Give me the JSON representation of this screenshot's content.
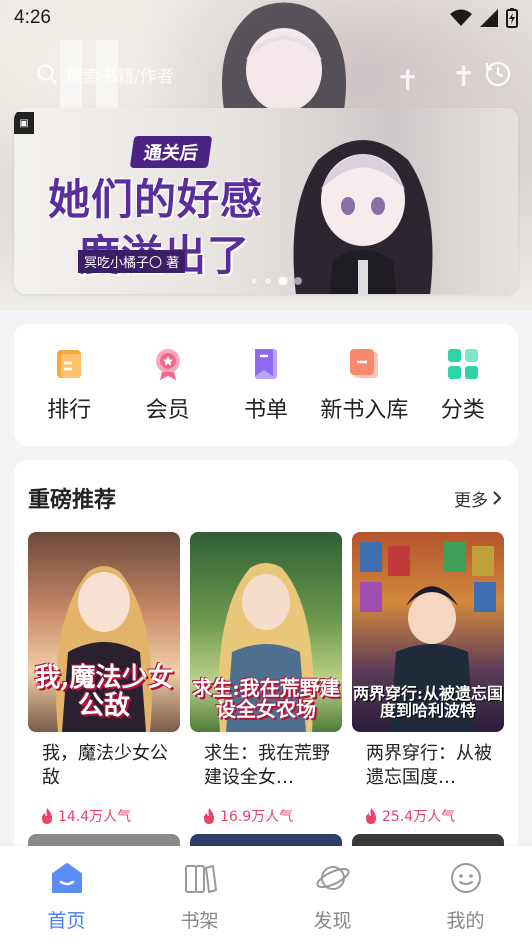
{
  "status_bar": {
    "time": "4:26"
  },
  "search": {
    "placeholder": "搜索书籍/作者"
  },
  "banner": {
    "badge": "通关后",
    "title_line1": "她们的好感",
    "title_line2": "度溢出了",
    "author": "冥吃小橘子〇 著",
    "page_count": 4,
    "active_index": 2
  },
  "quick_menu": [
    {
      "label": "排行",
      "icon": "ranking-icon",
      "color": "#f5a93c"
    },
    {
      "label": "会员",
      "icon": "vip-icon",
      "color": "#f06a8a"
    },
    {
      "label": "书单",
      "icon": "booklist-icon",
      "color": "#8d6af0"
    },
    {
      "label": "新书入库",
      "icon": "new-book-icon",
      "color": "#f58a6e"
    },
    {
      "label": "分类",
      "icon": "category-icon",
      "color": "#2fd3a8"
    }
  ],
  "recommend": {
    "title": "重磅推荐",
    "more": "更多",
    "books": [
      {
        "title": "我，魔法少女公敌",
        "popularity": "14.4万人气",
        "cover_text": "我,魔法少女公敌"
      },
      {
        "title": "求生：我在荒野建设全女…",
        "popularity": "16.9万人气",
        "cover_text": "求生:我在荒野建设全女农场"
      },
      {
        "title": "两界穿行：从被遗忘国度…",
        "popularity": "25.4万人气",
        "cover_text": "两界穿行:从被遗忘国度到哈利波特"
      }
    ]
  },
  "bottom_nav": [
    {
      "label": "首页",
      "icon": "home-icon",
      "active": true
    },
    {
      "label": "书架",
      "icon": "bookshelf-icon",
      "active": false
    },
    {
      "label": "发现",
      "icon": "discover-icon",
      "active": false
    },
    {
      "label": "我的",
      "icon": "profile-icon",
      "active": false
    }
  ],
  "colors": {
    "accent": "#4a7cf0",
    "popularity": "#e8436a"
  }
}
